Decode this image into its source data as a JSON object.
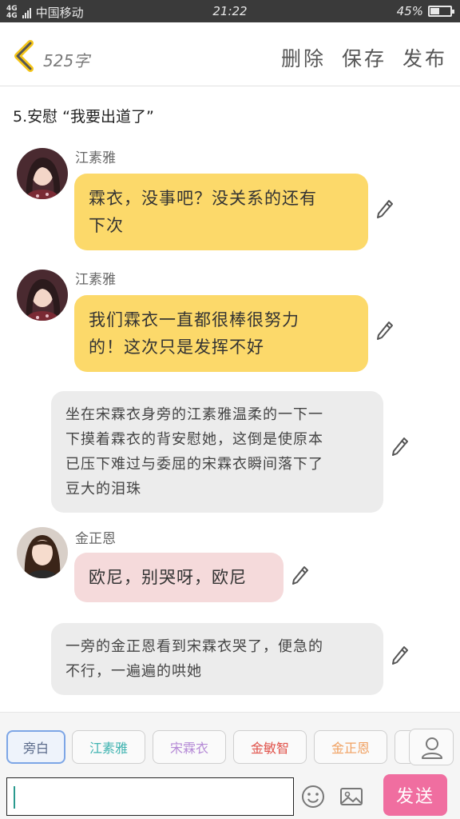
{
  "status_bar": {
    "network": "4G",
    "carrier": "中国移动",
    "time": "21:22",
    "battery_percent_text": "45%",
    "battery_level": 0.45
  },
  "header": {
    "word_count": "525字",
    "delete_label": "删除",
    "save_label": "保存",
    "publish_label": "发布"
  },
  "chapter_title": "5.安慰 “我要出道了”",
  "messages": [
    {
      "type": "character",
      "speaker": "江素雅",
      "text_line1": "霖衣，没事吧？没关系的还有",
      "text_line2": "下次",
      "color": "#fcd96a"
    },
    {
      "type": "character",
      "speaker": "江素雅",
      "text_line1": "我们霖衣一直都很棒很努力",
      "text_line2": "的！这次只是发挥不好",
      "color": "#fcd96a"
    },
    {
      "type": "narration",
      "text_line1": "坐在宋霖衣身旁的江素雅温柔的一下一",
      "text_line2": "下摸着霖衣的背安慰她，这倒是使原本",
      "text_line3": "已压下难过与委屈的宋霖衣瞬间落下了",
      "text_line4": "豆大的泪珠",
      "color": "#ececec"
    },
    {
      "type": "character",
      "speaker": "金正恩",
      "text_line1": "欧尼，别哭呀，欧尼",
      "color": "#f5dadb"
    },
    {
      "type": "narration",
      "text_line1": "一旁的金正恩看到宋霖衣哭了，便急的",
      "text_line2": "不行，一遍遍的哄她",
      "color": "#ececec"
    }
  ],
  "roles": [
    {
      "label": "旁白",
      "color": "#5a6a8a"
    },
    {
      "label": "江素雅",
      "color": "#3fb3b0"
    },
    {
      "label": "宋霖衣",
      "color": "#b58ad6"
    },
    {
      "label": "金敏智",
      "color": "#e0524a"
    },
    {
      "label": "金正恩",
      "color": "#f0a060"
    }
  ],
  "input": {
    "value": "",
    "send_label": "发送"
  },
  "icons": {
    "back": "chevron-left-icon",
    "edit": "pencil-icon",
    "person": "person-icon",
    "emoji": "smiley-icon",
    "image": "image-icon"
  },
  "colors": {
    "accent_yellow": "#f5c518",
    "send_pink": "#f06ea0"
  }
}
